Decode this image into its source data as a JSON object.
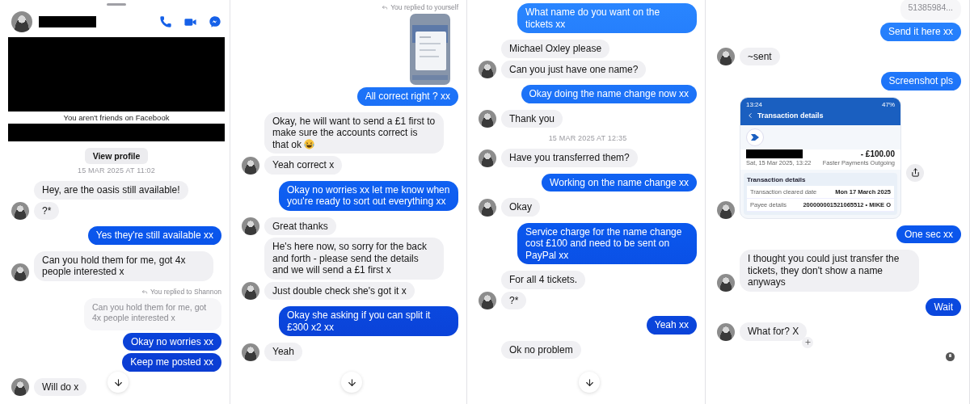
{
  "panels": [
    {
      "items": [
        {
          "kind": "header"
        },
        {
          "kind": "redacted_block"
        },
        {
          "kind": "notice",
          "text": "You aren't friends on Facebook"
        },
        {
          "kind": "redacted_bar"
        },
        {
          "kind": "button",
          "text": "View profile"
        },
        {
          "kind": "timestamp",
          "text": "15 MAR 2025 AT 11:02"
        },
        {
          "kind": "received",
          "text": "Hey, are the oasis still available!",
          "avatar": false
        },
        {
          "kind": "received",
          "text": "?*",
          "avatar": true
        },
        {
          "kind": "sent",
          "text": "Yes they're still available xx"
        },
        {
          "kind": "received",
          "text": "Can you hold them for me, got 4x people interested x",
          "avatar": true
        },
        {
          "kind": "reply_label",
          "text": "You replied to Shannon"
        },
        {
          "kind": "quoted",
          "text": "Can you hold them for me, got 4x people interested x"
        },
        {
          "kind": "sent",
          "text": "Okay no worries xx"
        },
        {
          "kind": "sent",
          "text": "Keep me posted xx"
        },
        {
          "kind": "received",
          "text": "Will do x",
          "avatar": true
        },
        {
          "kind": "jump_button"
        }
      ]
    },
    {
      "items": [
        {
          "kind": "reply_label",
          "text": "You replied to yourself"
        },
        {
          "kind": "image"
        },
        {
          "kind": "sent",
          "text": "All correct right ? xx"
        },
        {
          "kind": "received",
          "text": "Okay, he will want to send a £1 first to make sure the accounts correct is that ok",
          "avatar": false,
          "emoji": true
        },
        {
          "kind": "received",
          "text": "Yeah correct x",
          "avatar": true
        },
        {
          "kind": "sent",
          "text": "Okay no worries xx let me know when you're ready to sort out everything xx"
        },
        {
          "kind": "received",
          "text": "Great thanks",
          "avatar": true
        },
        {
          "kind": "received",
          "text": "He's here now, so sorry for the back and forth - please send the details and we will send a £1 first x",
          "avatar": false
        },
        {
          "kind": "received",
          "text": "Just double check she's got it x",
          "avatar": true
        },
        {
          "kind": "sent",
          "text": "Okay she asking if you can split it £300 x2 xx"
        },
        {
          "kind": "received",
          "text": "Yeah",
          "avatar": true
        },
        {
          "kind": "jump_button"
        }
      ]
    },
    {
      "items": [
        {
          "kind": "sent",
          "text": "What name do you want on the tickets xx"
        },
        {
          "kind": "received",
          "text": "Michael Oxley please",
          "avatar": false
        },
        {
          "kind": "received",
          "text": "Can you just have one name?",
          "avatar": true
        },
        {
          "kind": "sent",
          "text": "Okay doing the name change now xx"
        },
        {
          "kind": "received",
          "text": "Thank you",
          "avatar": true
        },
        {
          "kind": "timestamp",
          "text": "15 MAR 2025 AT 12:35"
        },
        {
          "kind": "received",
          "text": "Have you transferred them?",
          "avatar": true
        },
        {
          "kind": "sent",
          "text": "Working on the name change xx"
        },
        {
          "kind": "received",
          "text": "Okay",
          "avatar": true
        },
        {
          "kind": "sent",
          "text": "Service charge for the name change cost £100 and need to be sent on PayPal xx"
        },
        {
          "kind": "received",
          "text": "For all 4 tickets.",
          "avatar": false
        },
        {
          "kind": "received",
          "text": "?*",
          "avatar": true
        },
        {
          "kind": "sent",
          "text": "Yeah xx"
        },
        {
          "kind": "received",
          "text": "Ok no problem",
          "avatar": false
        },
        {
          "kind": "jump_button"
        }
      ]
    },
    {
      "items": [
        {
          "kind": "quoted",
          "text": "51385984..."
        },
        {
          "kind": "sent",
          "text": "Send it here xx"
        },
        {
          "kind": "received",
          "text": "~sent",
          "avatar": true
        },
        {
          "kind": "sent",
          "text": "Screenshot pls"
        },
        {
          "kind": "transaction",
          "avatar": true,
          "status_time": "13:24",
          "battery": "47%",
          "title": "Transaction details",
          "amount": "- £100.00",
          "date": "Sat, 15 Mar 2025, 13:22",
          "method": "Faster Payments Outgoing",
          "section": "Transaction details",
          "rows": [
            {
              "label": "Transaction cleared date",
              "value": "Mon 17 March 2025"
            },
            {
              "label": "Payee details",
              "value": "200000001521065512 • MIKE O"
            }
          ]
        },
        {
          "kind": "sent",
          "text": "One sec xx"
        },
        {
          "kind": "received",
          "text": "I thought you could just transfer the tickets, they don't show a name anyways",
          "avatar": true
        },
        {
          "kind": "sent",
          "text": "Wait"
        },
        {
          "kind": "received",
          "text": "What for? X",
          "avatar": true,
          "reaction_button": true
        },
        {
          "kind": "seen"
        }
      ]
    }
  ]
}
